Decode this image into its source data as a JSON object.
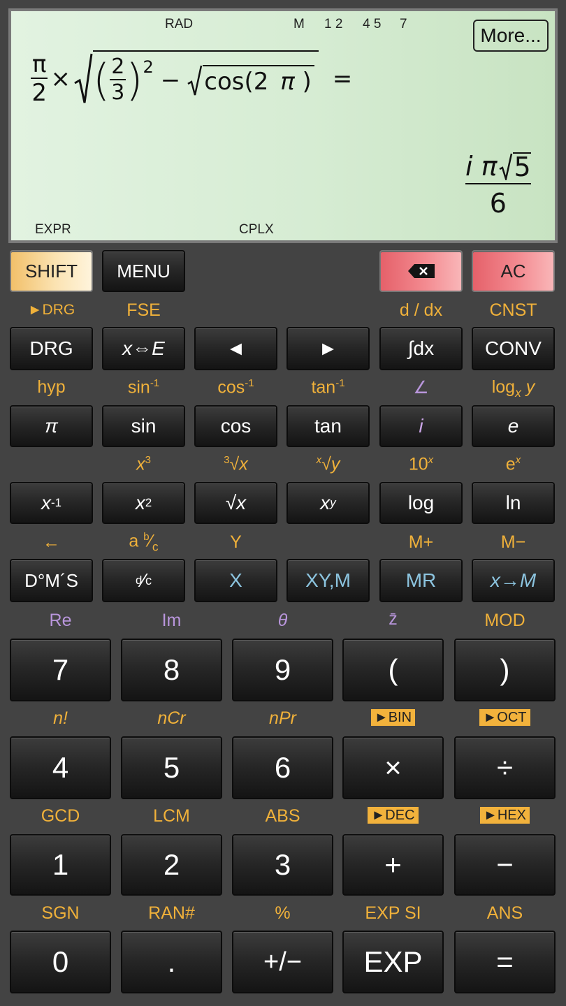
{
  "display": {
    "indicators": {
      "rad": "RAD",
      "memory": "M",
      "digits1": "1 2",
      "digits2": "4 5",
      "digit3": "7",
      "expr": "EXPR",
      "cplx": "CPLX"
    },
    "more_button": "More...",
    "expression": {
      "pi": "π",
      "two": "2",
      "times": "×",
      "two_b": "2",
      "three": "3",
      "exp": "2",
      "minus": "−",
      "cos": "cos(2",
      "pi2": "π",
      ")": ")",
      "equals": "="
    },
    "result": {
      "num": "i π",
      "radicand": "5",
      "den": "6"
    }
  },
  "top_row": {
    "shift": "SHIFT",
    "menu": "MENU",
    "ac": "AC"
  },
  "labels": {
    "row1": [
      "►DRG",
      "FSE",
      "d / dx",
      "CNST"
    ],
    "row2": [
      "hyp",
      "sin",
      "-1",
      "cos",
      "-1",
      "tan",
      "-1",
      "∠",
      "log",
      "x",
      "y"
    ],
    "row3": [
      "x",
      "3",
      "3",
      "√x",
      "x",
      "√y",
      "10",
      "x",
      "e",
      "x"
    ],
    "row4": [
      "←",
      "a",
      "b",
      "⁄",
      "c",
      "Y",
      "M+",
      "M−"
    ],
    "row5": [
      "Re",
      "Im",
      "θ",
      "z̄",
      "MOD"
    ],
    "row6": [
      "n!",
      "nCr",
      "nPr",
      "►BIN",
      "►OCT"
    ],
    "row7": [
      "GCD",
      "LCM",
      "ABS",
      "►DEC",
      "►HEX"
    ],
    "row8": [
      "SGN",
      "RAN#",
      "%",
      "EXP SI",
      "ANS"
    ]
  },
  "keys": {
    "r1": [
      "DRG",
      "x⇔E",
      "◄",
      "►",
      "∫dx",
      "CONV"
    ],
    "r2": [
      "π",
      "sin",
      "cos",
      "tan",
      "i",
      "e"
    ],
    "r3": [
      "x",
      "-1",
      "x",
      "2",
      "√x",
      "x",
      "y",
      "log",
      "ln"
    ],
    "r4": [
      "D°M´S",
      "d",
      "⁄",
      "c",
      "X",
      "XY,M",
      "MR",
      "x→M"
    ],
    "r5": [
      "7",
      "8",
      "9",
      "(",
      ")"
    ],
    "r6": [
      "4",
      "5",
      "6",
      "×",
      "÷"
    ],
    "r7": [
      "1",
      "2",
      "3",
      "+",
      "−"
    ],
    "r8": [
      "0",
      ".",
      "+/−",
      "EXP",
      "="
    ]
  },
  "colors": {
    "lcd_bg": "#d6ecd3",
    "label_orange": "#f0b13a",
    "label_purple": "#b996dc",
    "key_blue": "#8cc4df",
    "shift": "#f2c06a",
    "red": "#e5616a"
  }
}
